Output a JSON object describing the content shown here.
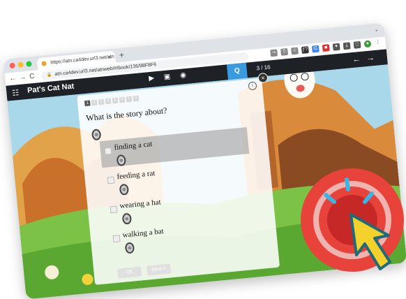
{
  "browser": {
    "tab_title": "https://atn.ca4dev.url3.net/atn",
    "tab_close": "×",
    "new_tab": "+",
    "tab_menu": "⌄",
    "back": "←",
    "forward": "→",
    "reload": "C",
    "url": "atn.ca4dev.url3.net/atnweb/#/book/136/98F8F6",
    "toolbar_glyphs": [
      "⊸",
      "⇧",
      "☆",
      "ƒ?",
      "G",
      "■",
      "✦",
      "⤓",
      "□",
      "●",
      "⋮"
    ]
  },
  "app": {
    "title": "Pat's Cat Nat",
    "menu_icon": "☷",
    "media_icons": [
      "▶",
      "▣",
      "◉"
    ],
    "quiz_button": "Q",
    "page_indicator": "3 / 16",
    "prev_arrow": "←",
    "next_arrow": "→"
  },
  "quiz": {
    "steps": [
      "1",
      "2",
      "3",
      "4",
      "5",
      "6",
      "7",
      "8"
    ],
    "active_step": 1,
    "info_icon": "i",
    "close_icon": "×",
    "question": "What is the story about?",
    "options": [
      {
        "label": "finding a cat",
        "selected": true
      },
      {
        "label": "feeding a rat",
        "selected": false
      },
      {
        "label": "wearing a hat",
        "selected": false
      },
      {
        "label": "walking a bat",
        "selected": false
      }
    ],
    "ok_label": "OK",
    "next_label": "Next >"
  },
  "colors": {
    "appbar": "#1e2227",
    "quiz_accent": "#3a9ae0",
    "click_icon_outer": "#e8433b",
    "click_icon_cursor": "#f5d22b"
  }
}
